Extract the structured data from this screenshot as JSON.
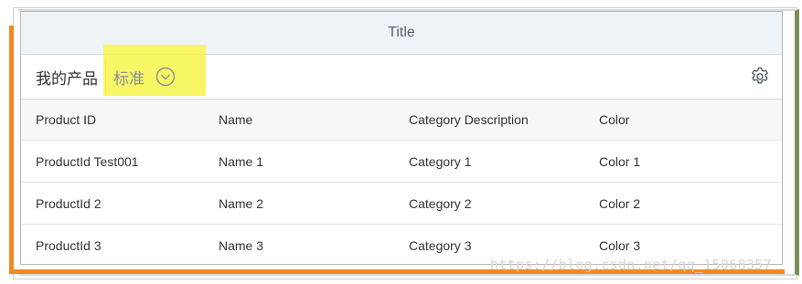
{
  "panel": {
    "title": "Title"
  },
  "toolbar": {
    "label": "我的产品",
    "variant": "标准",
    "chevron_icon": "chevron-down-circle-icon",
    "settings_icon": "gear-icon"
  },
  "table": {
    "columns": [
      "Product ID",
      "Name",
      "Category Description",
      "Color"
    ],
    "rows": [
      [
        "ProductId Test001",
        "Name 1",
        "Category 1",
        "Color 1"
      ],
      [
        "ProductId 2",
        "Name 2",
        "Category 2",
        "Color 2"
      ],
      [
        "ProductId 3",
        "Name 3",
        "Category 3",
        "Color 3"
      ]
    ]
  },
  "watermark": "https://blog.csdn.net/qq_15068357",
  "colors": {
    "accent_orange": "#f08a24",
    "accent_green": "#7a8f56",
    "highlight": "#f7f54a",
    "title_bg": "#eef3f8"
  }
}
